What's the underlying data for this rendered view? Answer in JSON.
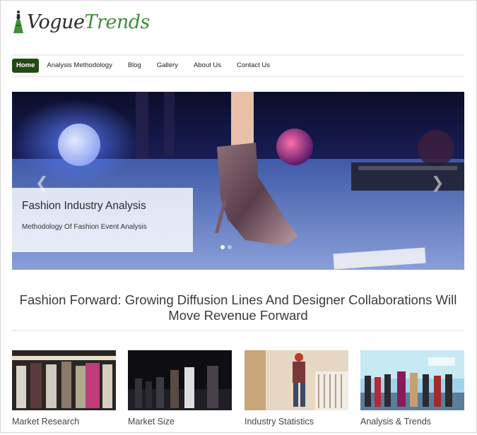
{
  "logo": {
    "part1": "Vogue",
    "part2": "Trends",
    "icon": "dress-icon",
    "accent": "#3f8f3a"
  },
  "nav": {
    "active_color": "#224a14",
    "items": [
      {
        "label": "Home"
      },
      {
        "label": "Analysis Methodology"
      },
      {
        "label": "Blog"
      },
      {
        "label": "Gallery"
      },
      {
        "label": "About Us"
      },
      {
        "label": "Contact Us"
      }
    ]
  },
  "slider": {
    "title": "Fashion Industry Analysis",
    "subtitle": "Methodology Of Fashion Event Analysis",
    "prev_icon": "chevron-left-icon",
    "next_icon": "chevron-right-icon",
    "slide_count": 2,
    "active_slide": 1
  },
  "headline": "Fashion Forward: Growing Diffusion Lines And Designer Collaborations Will Move Revenue Forward",
  "thumbnails": [
    {
      "label": "Market Research"
    },
    {
      "label": "Market Size"
    },
    {
      "label": "Industry Statistics"
    },
    {
      "label": "Analysis & Trends"
    }
  ]
}
